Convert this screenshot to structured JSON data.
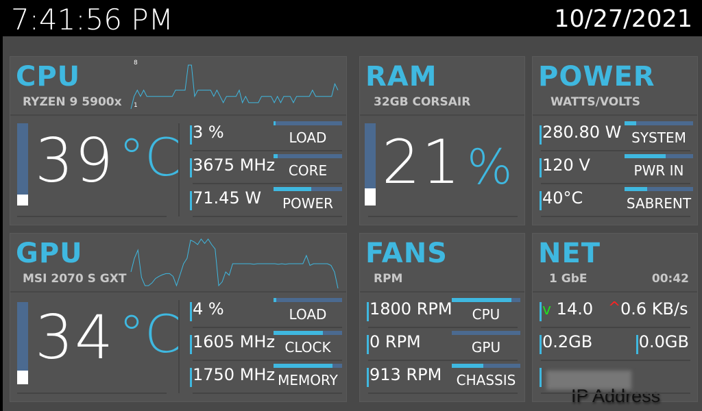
{
  "header": {
    "time": "7:41:56 PM",
    "date": "10/27/2021"
  },
  "cpu": {
    "title": "CPU",
    "subtitle": "RYZEN 9 5900x",
    "graph_max_label": "8",
    "graph_min_label": "1",
    "graph_values": [
      1,
      3,
      4,
      3,
      4,
      3,
      3,
      3,
      3,
      3,
      3,
      3,
      3,
      3,
      4,
      4,
      4,
      4,
      8,
      8,
      3,
      4,
      4,
      4,
      4,
      4,
      3,
      4,
      3,
      2,
      3,
      3,
      3,
      3,
      4,
      2,
      3,
      2,
      2,
      2,
      2,
      3,
      3,
      3,
      3,
      2,
      3,
      2,
      3,
      3,
      3,
      2,
      3,
      3,
      3,
      3,
      3,
      4,
      3,
      3,
      3,
      3,
      3,
      3,
      5,
      4
    ],
    "temperature": "39",
    "temp_unit": "°C",
    "temp_fraction": 0.13,
    "rows": [
      {
        "value": "3 %",
        "label": "LOAD",
        "fraction": 0.03
      },
      {
        "value": "3675 MHz",
        "label": "CORE",
        "fraction": 0.06
      },
      {
        "value": "71.45 W",
        "label": "POWER",
        "fraction": 0.55
      }
    ]
  },
  "ram": {
    "title": "RAM",
    "subtitle": "32GB CORSAIR",
    "value": "21",
    "unit": "%",
    "fraction": 0.21
  },
  "power": {
    "title": "POWER",
    "subtitle": "WATTS/VOLTS",
    "rows": [
      {
        "value": "280.80 W",
        "label": "SYSTEM",
        "fraction": 0.17
      },
      {
        "value": "120 V",
        "label": "PWR IN",
        "fraction": 0.6
      },
      {
        "value": "40°C",
        "label": "SABRENT",
        "fraction": 0.33
      }
    ]
  },
  "gpu": {
    "title": "GPU",
    "subtitle": "MSI 2070 S GXT",
    "graph_values": [
      30,
      55,
      70,
      20,
      5,
      5,
      10,
      18,
      22,
      25,
      27,
      27,
      22,
      5,
      25,
      45,
      55,
      88,
      85,
      80,
      90,
      82,
      90,
      80,
      72,
      5,
      12,
      30,
      24,
      45,
      45,
      45,
      45,
      45,
      45,
      44,
      45,
      45,
      45,
      45,
      45,
      45,
      44,
      45,
      44,
      45,
      45,
      45,
      45,
      45,
      60,
      42,
      45,
      45,
      45,
      45,
      45,
      42,
      30,
      0
    ],
    "temperature": "34",
    "temp_unit": "°C",
    "temp_fraction": 0.17,
    "rows": [
      {
        "value": "4 %",
        "label": "LOAD",
        "fraction": 0.04
      },
      {
        "value": "1605 MHz",
        "label": "CLOCK",
        "fraction": 0.72
      },
      {
        "value": "1750 MHz",
        "label": "MEMORY",
        "fraction": 0.86
      }
    ]
  },
  "fans": {
    "title": "FANS",
    "subtitle": "RPM",
    "rows": [
      {
        "value": "1800 RPM",
        "label": "CPU",
        "fraction": 0.87
      },
      {
        "value": "0 RPM",
        "label": "GPU",
        "fraction": 0.0
      },
      {
        "value": "913 RPM",
        "label": "CHASSIS",
        "fraction": 0.46
      }
    ]
  },
  "net": {
    "title": "NET",
    "subtitle": "1 GbE",
    "uptime": "00:42",
    "download_icon": "v",
    "download": "14.0",
    "upload_icon": "^",
    "upload": "0.6 KB/s",
    "total_down": "0.2GB",
    "total_up": "0.0GB",
    "ip_label": "IP Address"
  }
}
